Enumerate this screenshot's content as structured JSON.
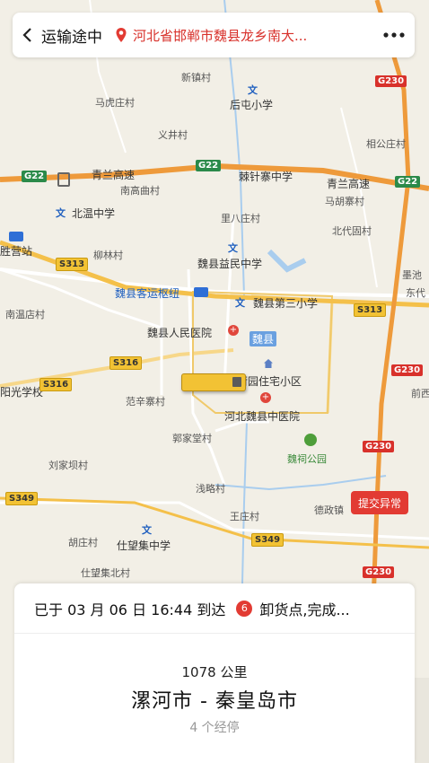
{
  "header": {
    "back_icon": "chevron-left-icon",
    "title": "运输途中",
    "location": "河北省邯郸市魏县龙乡南大...",
    "more_icon": "more-horizontal-icon"
  },
  "map": {
    "places": [
      {
        "name": "新镇村",
        "key": "p1"
      },
      {
        "name": "马虎庄村",
        "key": "p2"
      },
      {
        "name": "后屯小学",
        "key": "p3"
      },
      {
        "name": "义井村",
        "key": "p4"
      },
      {
        "name": "相公庄村",
        "key": "p5"
      },
      {
        "name": "南高曲村",
        "key": "p6"
      },
      {
        "name": "马胡寨村",
        "key": "p7"
      },
      {
        "name": "北温中学",
        "key": "p8"
      },
      {
        "name": "里八庄村",
        "key": "p9"
      },
      {
        "name": "北代固村",
        "key": "p10"
      },
      {
        "name": "柳林村",
        "key": "p11"
      },
      {
        "name": "魏县益民中学",
        "key": "p12"
      },
      {
        "name": "胜营站",
        "key": "p13"
      },
      {
        "name": "魏县客运枢纽",
        "key": "p14"
      },
      {
        "name": "魏县第三小学",
        "key": "p15"
      },
      {
        "name": "南温店村",
        "key": "p16"
      },
      {
        "name": "魏县人民医院",
        "key": "p17"
      },
      {
        "name": "魏县",
        "key": "p18"
      },
      {
        "name": "荷园住宅小区",
        "key": "p19"
      },
      {
        "name": "阳光学校",
        "key": "p20"
      },
      {
        "name": "范辛寨村",
        "key": "p21"
      },
      {
        "name": "河北魏县中医院",
        "key": "p22"
      },
      {
        "name": "郭家堂村",
        "key": "p23"
      },
      {
        "name": "魏祠公园",
        "key": "p24"
      },
      {
        "name": "刘家坝村",
        "key": "p25"
      },
      {
        "name": "浅略村",
        "key": "p26"
      },
      {
        "name": "德政镇",
        "key": "p27"
      },
      {
        "name": "王庄村",
        "key": "p28"
      },
      {
        "name": "胡庄村",
        "key": "p29"
      },
      {
        "name": "仕望集中学",
        "key": "p30"
      },
      {
        "name": "仕望集北村",
        "key": "p31"
      },
      {
        "name": "青兰高速",
        "key": "p32"
      },
      {
        "name": "棘针寨中学",
        "key": "p33"
      },
      {
        "name": "墨池",
        "key": "p34"
      },
      {
        "name": "东代",
        "key": "p35"
      },
      {
        "name": "前西",
        "key": "p36"
      },
      {
        "name": "青兰高速",
        "key": "p37"
      }
    ],
    "shields": {
      "g230a": "G230",
      "g22a": "G22",
      "g22b": "G22",
      "g22c": "G22",
      "s313a": "S313",
      "s313b": "S313",
      "s316a": "S316",
      "s316b": "S316",
      "g230b": "G230",
      "g230c": "G230",
      "s349a": "S349",
      "s349b": "S349",
      "g230d": "G230"
    },
    "report_button": "提交异常"
  },
  "trip": {
    "arrival_text": "已于 03 月 06 日 16:44 到达",
    "stop_number": "6",
    "arrival_status": "卸货点,完成...",
    "distance": "1078 公里",
    "route": "漯河市 - 秦皇岛市",
    "via": "4 个经停"
  },
  "colors": {
    "accent": "#e23b33",
    "highway": "#f0a03a",
    "truck": "#f2c234"
  }
}
